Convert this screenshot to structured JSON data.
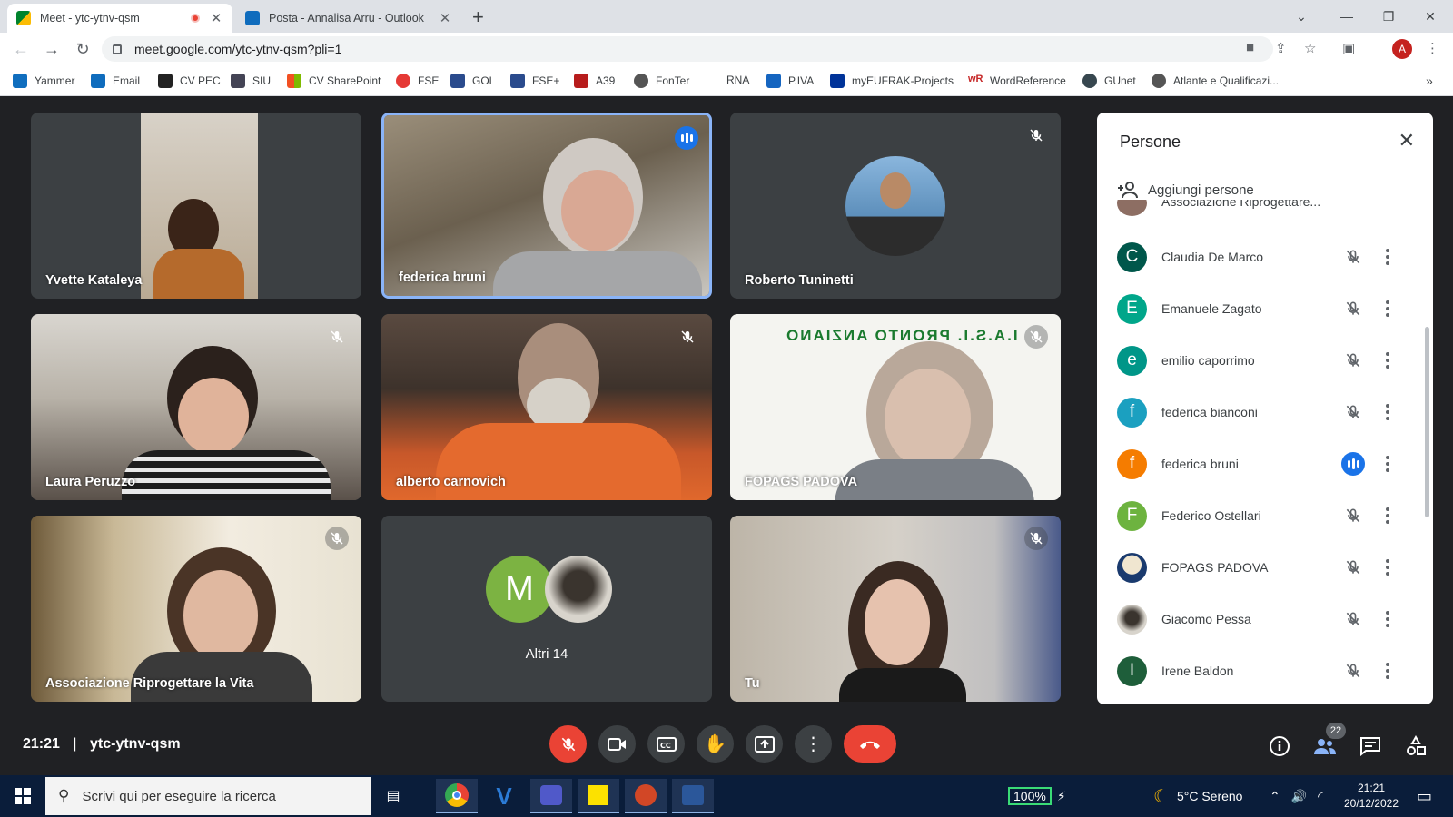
{
  "browser": {
    "tabs": [
      {
        "title": "Meet - ytc-ytnv-qsm",
        "active": true
      },
      {
        "title": "Posta - Annalisa Arru - Outlook",
        "active": false
      }
    ],
    "url": "meet.google.com/ytc-ytnv-qsm?pli=1",
    "profile_initial": "A",
    "bookmarks": [
      "Yammer",
      "Email",
      "CV PEC",
      "SIU",
      "CV SharePoint",
      "FSE",
      "GOL",
      "FSE+",
      "A39",
      "FonTer",
      "RNA",
      "P.IVA",
      "myEUFRAK-Projects",
      "WordReference",
      "GUnet",
      "Atlante e Qualificazi..."
    ]
  },
  "meet": {
    "tiles": [
      {
        "name": "Yvette Kataleya"
      },
      {
        "name": "federica bruni"
      },
      {
        "name": "Roberto Tuninetti"
      },
      {
        "name": "Laura Peruzzo"
      },
      {
        "name": "alberto carnovich"
      },
      {
        "name": "FOPAGS PADOVA",
        "banner": "I.A.S.I. PRONTO ANZIANO"
      },
      {
        "name": "Associazione Riprogettare la Vita"
      },
      {
        "name": "Altri 14",
        "avatar_initial": "M"
      },
      {
        "name": "Tu"
      }
    ],
    "time": "21:21",
    "separator": "|",
    "meeting_code": "ytc-ytnv-qsm",
    "participants_count": "22"
  },
  "people_panel": {
    "title": "Persone",
    "add_label": "Aggiungi persone",
    "partial_top": "Associazione Riprogettare...",
    "participants": [
      {
        "initial": "C",
        "name": "Claudia De Marco",
        "color": "#00574b",
        "speaking": false
      },
      {
        "initial": "E",
        "name": "Emanuele Zagato",
        "color": "#00a68a",
        "speaking": false
      },
      {
        "initial": "e",
        "name": "emilio caporrimo",
        "color": "#009688",
        "speaking": false
      },
      {
        "initial": "f",
        "name": "federica bianconi",
        "color": "#1ba0c0",
        "speaking": false
      },
      {
        "initial": "f",
        "name": "federica bruni",
        "color": "#f57c00",
        "speaking": true
      },
      {
        "initial": "F",
        "name": "Federico Ostellari",
        "color": "#6db33f",
        "speaking": false
      },
      {
        "initial": "",
        "name": "FOPAGS PADOVA",
        "color": "#1a3a6e",
        "speaking": false
      },
      {
        "initial": "",
        "name": "Giacomo Pessa",
        "color": "#777777",
        "speaking": false
      },
      {
        "initial": "I",
        "name": "Irene Baldon",
        "color": "#1e5e3a",
        "speaking": false
      }
    ]
  },
  "taskbar": {
    "search_placeholder": "Scrivi qui per eseguire la ricerca",
    "battery": "100%",
    "weather": "5°C Sereno",
    "time": "21:21",
    "date": "20/12/2022"
  }
}
